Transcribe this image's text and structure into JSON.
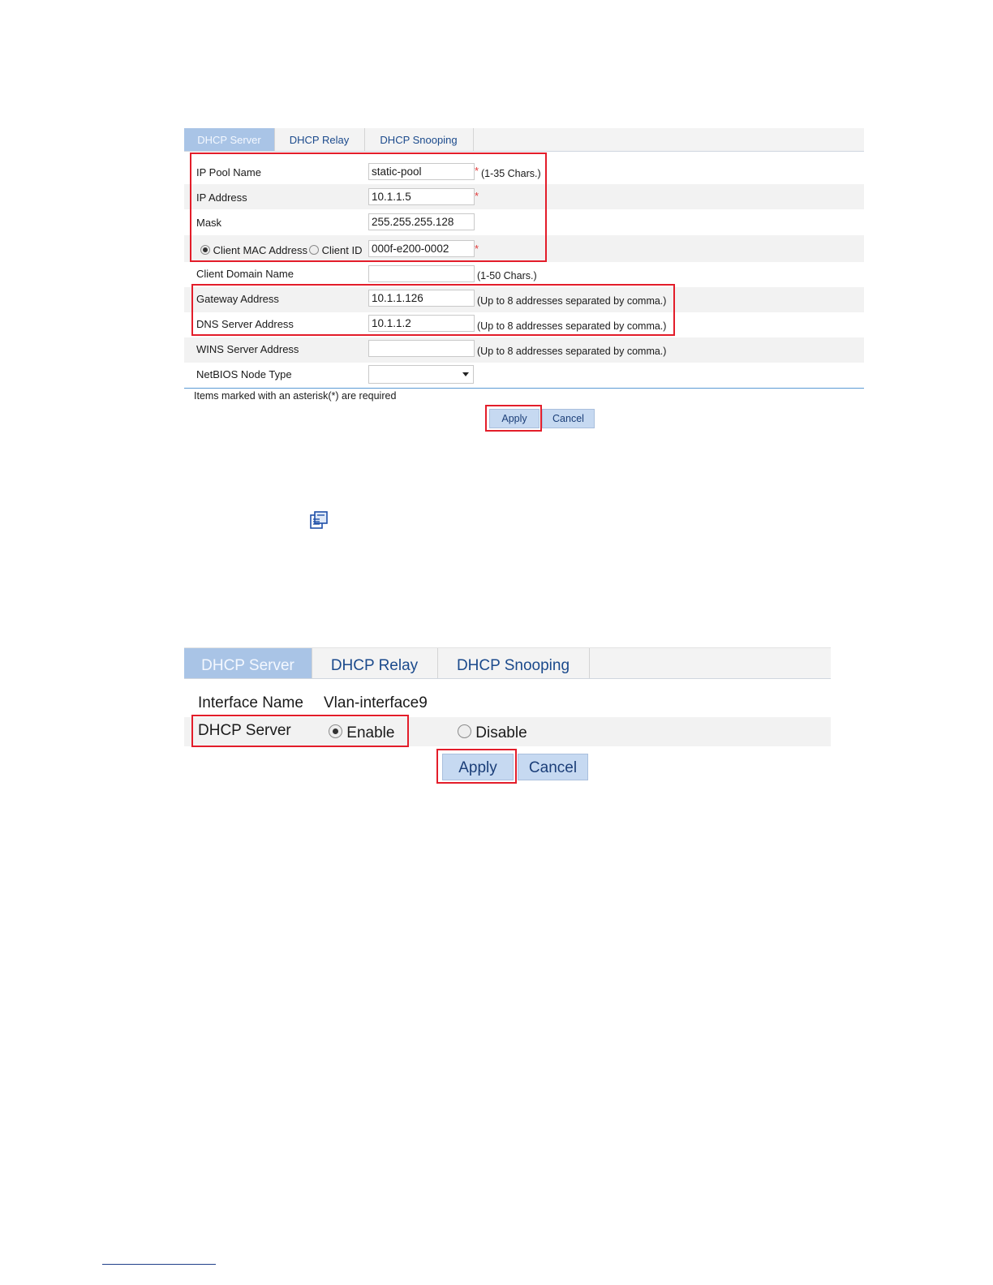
{
  "figure1": {
    "tabs": [
      "DHCP Server",
      "DHCP Relay",
      "DHCP Snooping"
    ],
    "ip_pool_name": {
      "label": "IP Pool Name",
      "value": "static-pool",
      "hint": "(1-35 Chars.)"
    },
    "ip_address": {
      "label": "IP Address",
      "value": "10.1.1.5"
    },
    "mask": {
      "label": "Mask",
      "value": "255.255.255.128"
    },
    "client_id_type": {
      "option_mac": "Client MAC Address",
      "option_id": "Client ID",
      "selected": "Client MAC Address",
      "value": "000f-e200-0002"
    },
    "client_domain_name": {
      "label": "Client Domain Name",
      "value": "",
      "hint": "(1-50 Chars.)"
    },
    "gateway_address": {
      "label": "Gateway Address",
      "value": "10.1.1.126",
      "hint": "(Up to 8 addresses separated by comma.)"
    },
    "dns_server_address": {
      "label": "DNS Server Address",
      "value": "10.1.1.2",
      "hint": "(Up to 8 addresses separated by comma.)"
    },
    "wins_server_address": {
      "label": "WINS Server Address",
      "value": "",
      "hint": "(Up to 8 addresses separated by comma.)"
    },
    "netbios_node_type": {
      "label": "NetBIOS Node Type",
      "value": ""
    },
    "required_note": "Items marked with an asterisk(*) are required",
    "asterisk": "*",
    "apply_label": "Apply",
    "cancel_label": "Cancel"
  },
  "icon_name": "note-icon",
  "figure2": {
    "tabs": [
      "DHCP Server",
      "DHCP Relay",
      "DHCP Snooping"
    ],
    "interface_name": {
      "label": "Interface Name",
      "value": "Vlan-interface9"
    },
    "dhcp_server": {
      "label": "DHCP Server",
      "option_enable": "Enable",
      "option_disable": "Disable",
      "selected": "Enable"
    },
    "apply_label": "Apply",
    "cancel_label": "Cancel"
  },
  "colors": {
    "highlight_box": "#e31d2a",
    "active_tab": "#a9c4e6",
    "button": "#c6d9f1",
    "tab_text": "#1b4a8c"
  }
}
